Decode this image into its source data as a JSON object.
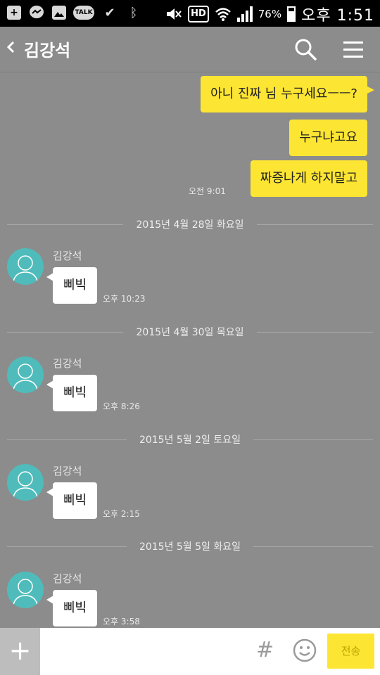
{
  "status_bar": {
    "talk_badge": "TALK",
    "hd": "HD",
    "battery_pct": "76%",
    "time": "오후 1:51"
  },
  "header": {
    "title": "김강석"
  },
  "messages_out": [
    {
      "text": "아니 진짜 님 누구세요ㅡㅡ?"
    },
    {
      "text": "누구냐고요"
    },
    {
      "text": "짜증나게 하지말고"
    }
  ],
  "out_time": "오전 9:01",
  "groups": [
    {
      "date": "2015년 4월 28일 화요일",
      "sender": "김강석",
      "text": "삐빅",
      "time": "오후 10:23"
    },
    {
      "date": "2015년 4월 30일 목요일",
      "sender": "김강석",
      "text": "삐빅",
      "time": "오후 8:26"
    },
    {
      "date": "2015년 5월 2일 토요일",
      "sender": "김강석",
      "text": "삐빅",
      "time": "오후 2:15"
    },
    {
      "date": "2015년 5월 5일 화요일",
      "sender": "김강석",
      "text": "삐빅",
      "time": "오후 3:58"
    }
  ],
  "input": {
    "plus": "+",
    "hash": "#",
    "send_label": "전송"
  },
  "colors": {
    "background": "#8c8c8c",
    "bubble_yellow": "#fde533",
    "avatar_teal": "#4fbcbb"
  }
}
